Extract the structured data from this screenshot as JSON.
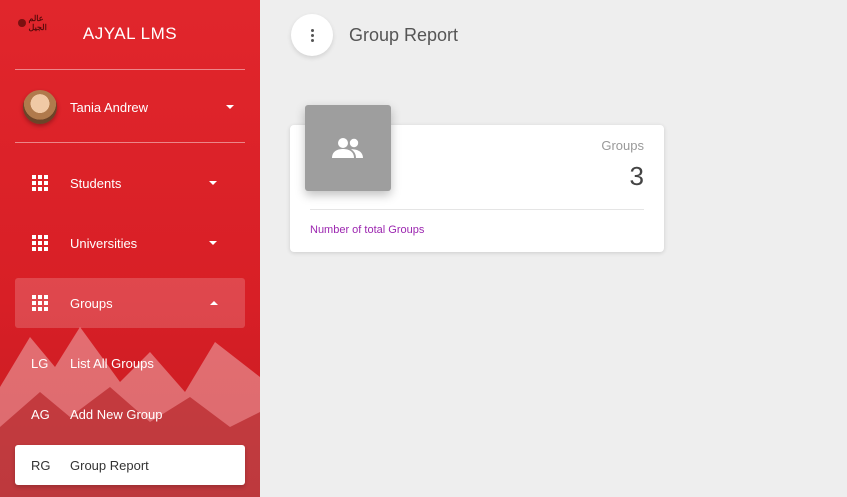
{
  "app": {
    "brand": "AJYAL LMS",
    "logo_text": "عالم الجيل"
  },
  "user": {
    "name": "Tania Andrew"
  },
  "nav": {
    "items": [
      {
        "label": "Students",
        "state": "collapsed"
      },
      {
        "label": "Universities",
        "state": "collapsed"
      },
      {
        "label": "Groups",
        "state": "expanded"
      }
    ],
    "groups_sub": [
      {
        "abbr": "LG",
        "label": "List All Groups"
      },
      {
        "abbr": "AG",
        "label": "Add New Group"
      },
      {
        "abbr": "RG",
        "label": "Group Report"
      }
    ]
  },
  "header": {
    "title": "Group Report"
  },
  "stats_card": {
    "category": "Groups",
    "value": "3",
    "footer": "Number of total Groups",
    "icon": "group-icon"
  },
  "colors": {
    "sidebar": "#e1262c",
    "accent_footer": "#9c27b0",
    "icon_bg": "#9e9e9e"
  }
}
